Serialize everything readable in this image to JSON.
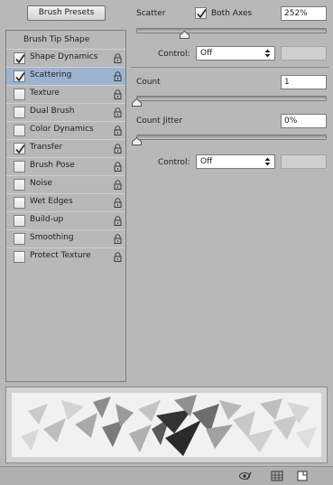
{
  "toolbar": {
    "brush_presets_label": "Brush Presets"
  },
  "list": {
    "header": "Brush Tip Shape",
    "items": [
      {
        "label": "Shape Dynamics",
        "checked": true,
        "selected": false
      },
      {
        "label": "Scattering",
        "checked": true,
        "selected": true
      },
      {
        "label": "Texture",
        "checked": false,
        "selected": false
      },
      {
        "label": "Dual Brush",
        "checked": false,
        "selected": false
      },
      {
        "label": "Color Dynamics",
        "checked": false,
        "selected": false
      },
      {
        "label": "Transfer",
        "checked": true,
        "selected": false
      },
      {
        "label": "Brush Pose",
        "checked": false,
        "selected": false
      },
      {
        "label": "Noise",
        "checked": false,
        "selected": false
      },
      {
        "label": "Wet Edges",
        "checked": false,
        "selected": false
      },
      {
        "label": "Build-up",
        "checked": false,
        "selected": false
      },
      {
        "label": "Smoothing",
        "checked": false,
        "selected": false
      },
      {
        "label": "Protect Texture",
        "checked": false,
        "selected": false
      }
    ]
  },
  "scatter": {
    "label": "Scatter",
    "both_axes_label": "Both Axes",
    "both_axes_checked": true,
    "value": "252%",
    "control_label": "Control:",
    "control_value": "Off"
  },
  "count": {
    "label": "Count",
    "value": "1"
  },
  "count_jitter": {
    "label": "Count Jitter",
    "value": "0%",
    "control_label": "Control:",
    "control_value": "Off"
  },
  "icons": [
    "lock-icon",
    "checkmark-icon",
    "eye-brush-icon",
    "grid-icon",
    "new-preset-icon"
  ]
}
